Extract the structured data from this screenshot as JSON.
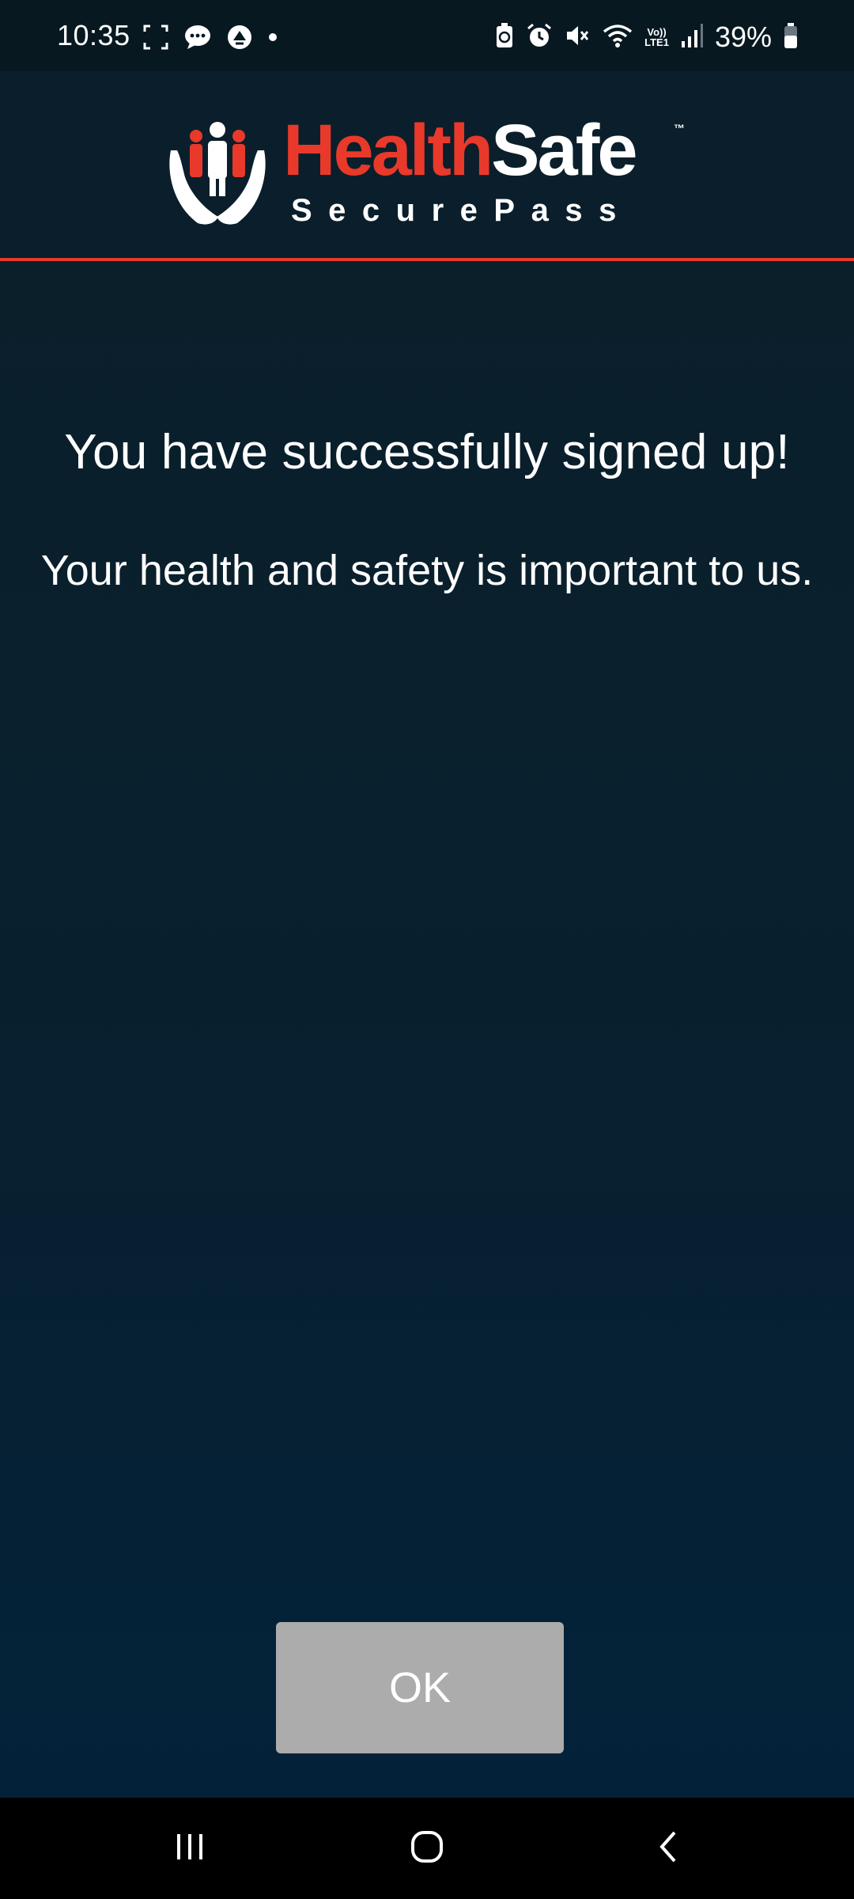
{
  "status_bar": {
    "time": "10:35",
    "battery_percent": "39%",
    "network_label_top": "Vo))",
    "network_label_bottom": "LTE1"
  },
  "header": {
    "logo_health": "Health",
    "logo_safe": "Safe",
    "logo_tm": "™",
    "logo_subtitle": "SecurePass",
    "accent_color": "#e8392a"
  },
  "main": {
    "headline": "You have successfully signed up!",
    "subline": "Your health and safety is important to us.",
    "ok_label": "OK"
  },
  "icons": {
    "status_left": [
      "screenshot-icon",
      "chat-icon",
      "sync-icon",
      "dot-icon"
    ],
    "status_right": [
      "battery-saver-icon",
      "alarm-icon",
      "mute-icon",
      "wifi-icon",
      "signal-icon",
      "battery-icon"
    ],
    "nav": [
      "recent-apps-icon",
      "home-icon",
      "back-icon"
    ]
  }
}
